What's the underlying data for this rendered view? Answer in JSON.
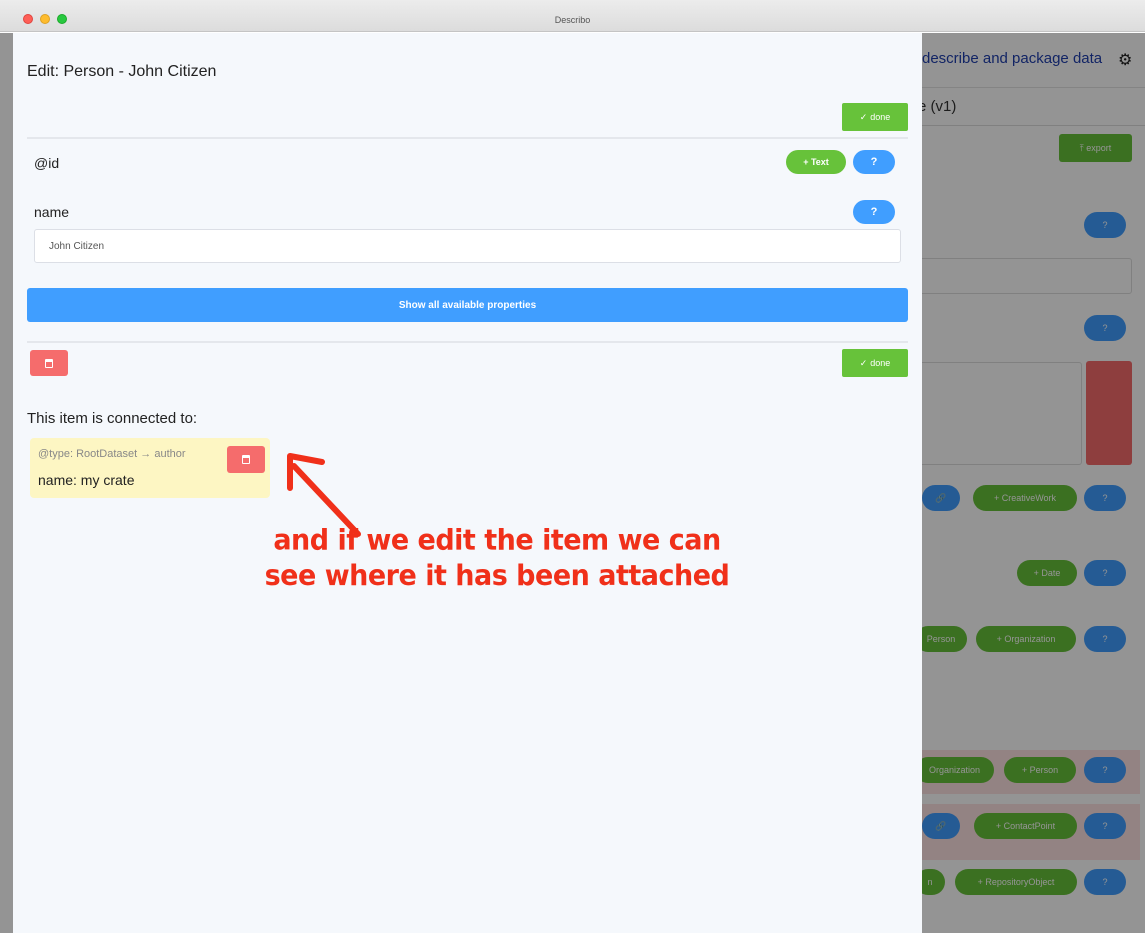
{
  "window": {
    "title": "Describo"
  },
  "background": {
    "header_title": "describe and package data",
    "tab_label": "e (v1)",
    "export_label": "export",
    "buttons": {
      "creative_work": "+ CreativeWork",
      "date": "+ Date",
      "person_partial": "Person",
      "organization": "+ Organization",
      "organization_partial": "Organization",
      "person": "+ Person",
      "contact_point": "+ ContactPoint",
      "n_partial": "n",
      "repository_object": "+ RepositoryObject",
      "help": "?"
    }
  },
  "drawer": {
    "title": "Edit: Person - John Citizen",
    "done_label": "done",
    "properties": [
      {
        "label": "@id",
        "add_label": "+ Text",
        "help": "?"
      },
      {
        "label": "name",
        "help": "?",
        "value": "John Citizen"
      }
    ],
    "show_all_label": "Show all available properties",
    "connected_label": "This item is connected to:",
    "connection": {
      "type_text": "@type: RootDataset",
      "relation": "→ author",
      "name_text": "name: my crate"
    }
  },
  "annotation": {
    "line1": "and if we edit the item we can",
    "line2": "see where it has been attached"
  },
  "colors": {
    "primary_blue": "#409eff",
    "success_green": "#67c23a",
    "danger_red": "#f56c6c",
    "card_yellow": "#fdf6c3",
    "annotation_red": "#f0301a"
  }
}
